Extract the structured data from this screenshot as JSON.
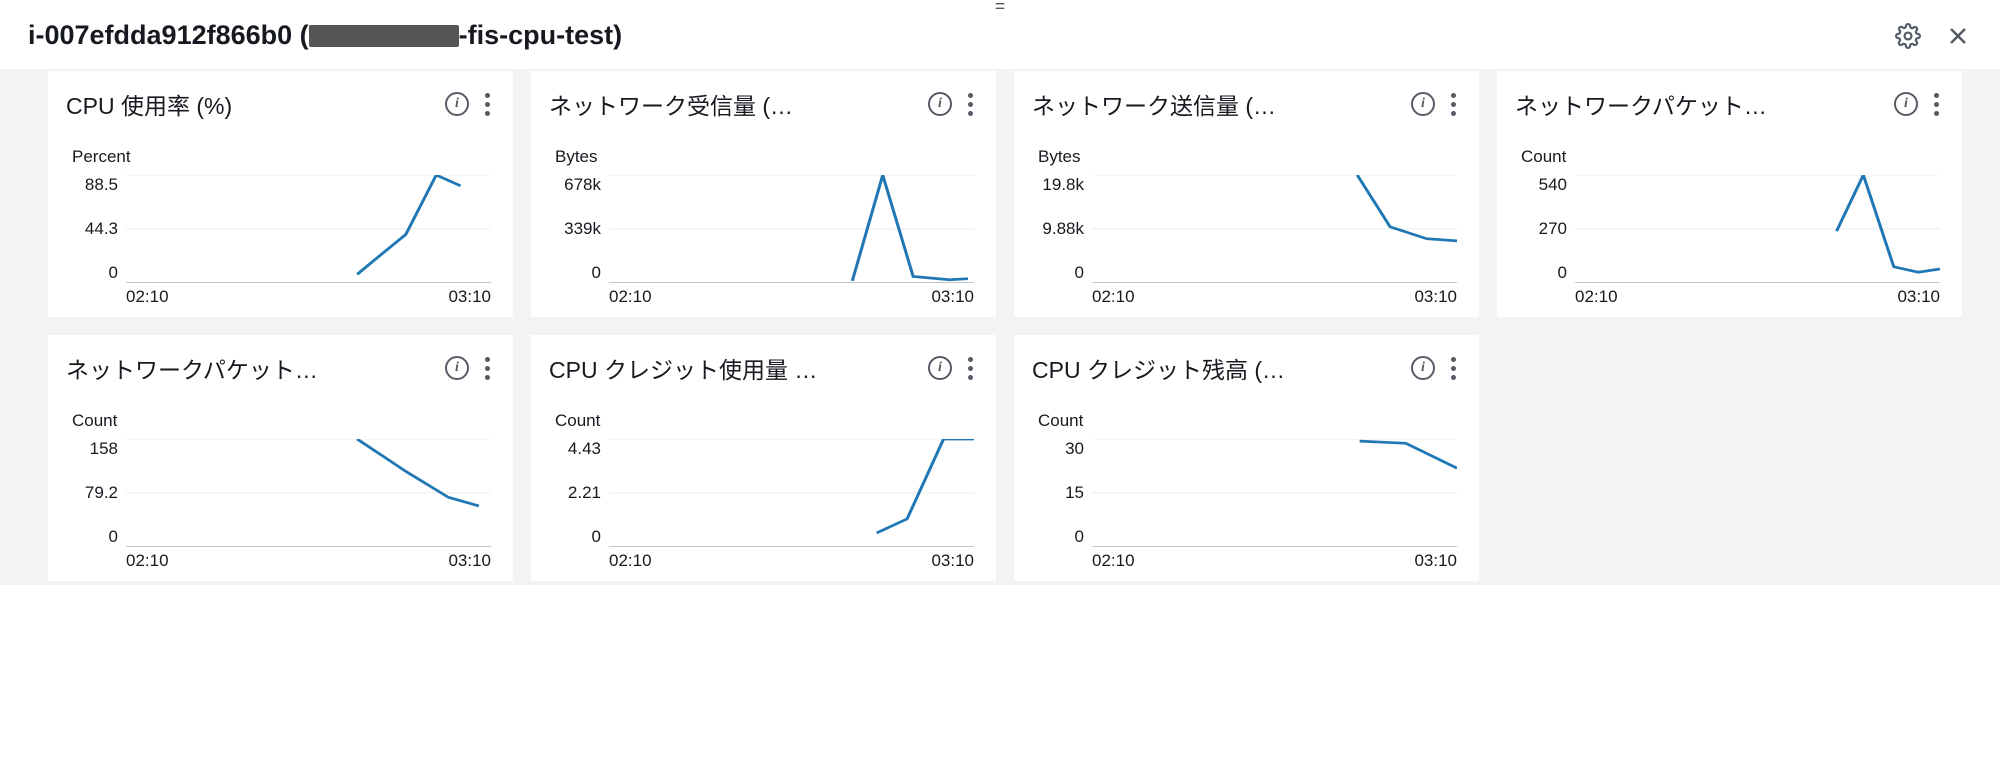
{
  "header": {
    "title_prefix": "i-007efdda912f866b0 (",
    "title_suffix": "-fis-cpu-test)"
  },
  "drag_handle": "=",
  "cards": [
    {
      "title": "CPU 使用率 (%)",
      "unit": "Percent",
      "yticks": [
        "88.5",
        "44.3",
        "0"
      ],
      "xstart": "02:10",
      "xend": "03:10"
    },
    {
      "title": "ネットワーク受信量 (…",
      "unit": "Bytes",
      "yticks": [
        "678k",
        "339k",
        "0"
      ],
      "xstart": "02:10",
      "xend": "03:10"
    },
    {
      "title": "ネットワーク送信量 (…",
      "unit": "Bytes",
      "yticks": [
        "19.8k",
        "9.88k",
        "0"
      ],
      "xstart": "02:10",
      "xend": "03:10"
    },
    {
      "title": "ネットワークパケット…",
      "unit": "Count",
      "yticks": [
        "540",
        "270",
        "0"
      ],
      "xstart": "02:10",
      "xend": "03:10"
    },
    {
      "title": "ネットワークパケット…",
      "unit": "Count",
      "yticks": [
        "158",
        "79.2",
        "0"
      ],
      "xstart": "02:10",
      "xend": "03:10"
    },
    {
      "title": "CPU クレジット使用量 …",
      "unit": "Count",
      "yticks": [
        "4.43",
        "2.21",
        "0"
      ],
      "xstart": "02:10",
      "xend": "03:10"
    },
    {
      "title": "CPU クレジット残高 (…",
      "unit": "Count",
      "yticks": [
        "30",
        "15",
        "0"
      ],
      "xstart": "02:10",
      "xend": "03:10"
    }
  ],
  "chart_data": [
    {
      "type": "line",
      "title": "CPU 使用率 (%)",
      "ylabel": "Percent",
      "xlim": [
        "02:10",
        "03:10"
      ],
      "ylim": [
        0,
        100
      ],
      "x": [
        "02:48",
        "02:52",
        "02:58",
        "03:03",
        "03:07"
      ],
      "values": [
        8,
        20,
        40,
        88.5,
        80
      ]
    },
    {
      "type": "line",
      "title": "ネットワーク受信量 (バイト)",
      "ylabel": "Bytes",
      "xlim": [
        "02:10",
        "03:10"
      ],
      "ylim": [
        0,
        750000
      ],
      "x": [
        "02:50",
        "02:55",
        "03:00",
        "03:05",
        "03:08"
      ],
      "values": [
        10000,
        678000,
        40000,
        15000,
        20000
      ]
    },
    {
      "type": "line",
      "title": "ネットワーク送信量 (バイト)",
      "ylabel": "Bytes",
      "xlim": [
        "02:10",
        "03:10"
      ],
      "ylim": [
        0,
        22000
      ],
      "x": [
        "02:55",
        "03:00",
        "03:05",
        "03:10"
      ],
      "values": [
        19800,
        10500,
        8500,
        8200
      ]
    },
    {
      "type": "line",
      "title": "ネットワークパケット (入力)",
      "ylabel": "Count",
      "xlim": [
        "02:10",
        "03:10"
      ],
      "ylim": [
        0,
        600
      ],
      "x": [
        "02:57",
        "03:01",
        "03:05",
        "03:08",
        "03:10"
      ],
      "values": [
        260,
        540,
        80,
        55,
        70
      ]
    },
    {
      "type": "line",
      "title": "ネットワークパケット (出力)",
      "ylabel": "Count",
      "xlim": [
        "02:10",
        "03:10"
      ],
      "ylim": [
        0,
        175
      ],
      "x": [
        "02:50",
        "02:58",
        "03:04",
        "03:08"
      ],
      "values": [
        158,
        110,
        72,
        60
      ]
    },
    {
      "type": "line",
      "title": "CPU クレジット使用量",
      "ylabel": "Count",
      "xlim": [
        "02:10",
        "03:10"
      ],
      "ylim": [
        0,
        5
      ],
      "x": [
        "02:55",
        "03:00",
        "03:05",
        "03:10"
      ],
      "values": [
        0.6,
        1.2,
        4.43,
        4.43
      ]
    },
    {
      "type": "line",
      "title": "CPU クレジット残高",
      "ylabel": "Count",
      "xlim": [
        "02:10",
        "03:10"
      ],
      "ylim": [
        0,
        33
      ],
      "x": [
        "02:55",
        "03:02",
        "03:10"
      ],
      "values": [
        30,
        29.5,
        22
      ]
    }
  ]
}
